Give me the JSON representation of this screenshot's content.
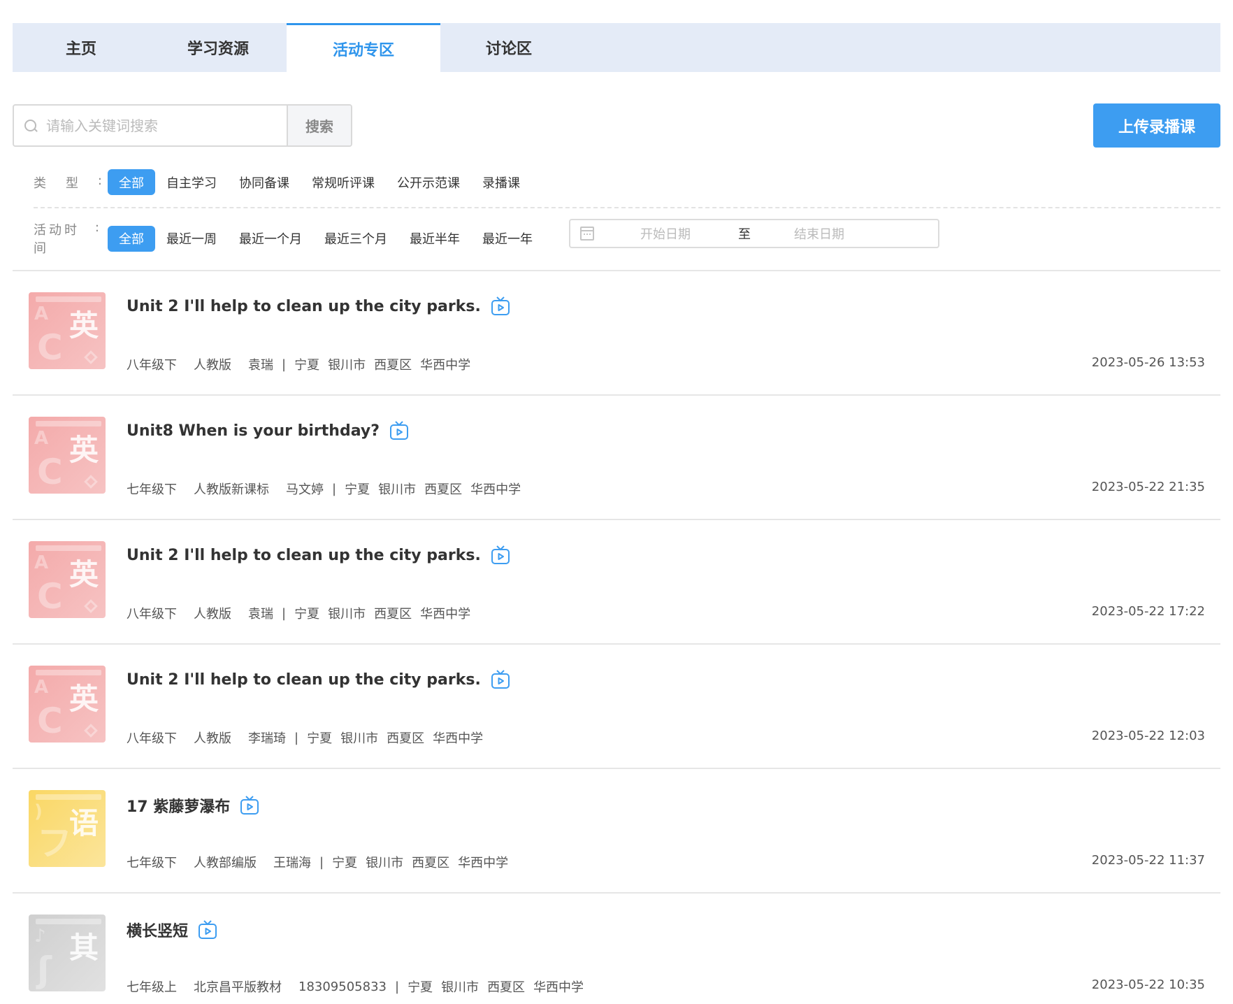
{
  "tabs": [
    {
      "label": "主页"
    },
    {
      "label": "学习资源"
    },
    {
      "label": "活动专区"
    },
    {
      "label": "讨论区"
    }
  ],
  "search": {
    "placeholder": "请输入关键词搜索",
    "button_label": "搜索"
  },
  "upload_button_label": "上传录播课",
  "filters": {
    "type": {
      "label_chars": [
        "类",
        "型",
        ":"
      ],
      "options": [
        "全部",
        "自主学习",
        "协同备课",
        "常规听评课",
        "公开示范课",
        "录播课"
      ],
      "selected": "全部"
    },
    "time": {
      "label_chars": [
        "活动时间",
        ":"
      ],
      "options": [
        "全部",
        "最近一周",
        "最近一个月",
        "最近三个月",
        "最近半年",
        "最近一年"
      ],
      "selected": "全部"
    },
    "date_range": {
      "start_placeholder": "开始日期",
      "separator": "至",
      "end_placeholder": "结束日期"
    }
  },
  "accent_color": "#3d9df1",
  "items": [
    {
      "title": "Unit 2 I'll help to clean up the city parks.",
      "subject_glyph": "英",
      "thumb_color": "red",
      "grade": "八年级下",
      "edition": "人教版",
      "teacher": "袁瑞",
      "sep": "|",
      "province": "宁夏",
      "city": "银川市",
      "district": "西夏区",
      "school": "华西中学",
      "date": "2023-05-26 13:53"
    },
    {
      "title": "Unit8 When is your birthday?",
      "subject_glyph": "英",
      "thumb_color": "red",
      "grade": "七年级下",
      "edition": "人教版新课标",
      "teacher": "马文婷",
      "sep": "|",
      "province": "宁夏",
      "city": "银川市",
      "district": "西夏区",
      "school": "华西中学",
      "date": "2023-05-22 21:35"
    },
    {
      "title": "Unit 2 I'll help to clean up the city parks.",
      "subject_glyph": "英",
      "thumb_color": "red",
      "grade": "八年级下",
      "edition": "人教版",
      "teacher": "袁瑞",
      "sep": "|",
      "province": "宁夏",
      "city": "银川市",
      "district": "西夏区",
      "school": "华西中学",
      "date": "2023-05-22 17:22"
    },
    {
      "title": "Unit 2 I'll help to clean up the city parks.",
      "subject_glyph": "英",
      "thumb_color": "red",
      "grade": "八年级下",
      "edition": "人教版",
      "teacher": "李瑞琦",
      "sep": "|",
      "province": "宁夏",
      "city": "银川市",
      "district": "西夏区",
      "school": "华西中学",
      "date": "2023-05-22 12:03"
    },
    {
      "title": "17 紫藤萝瀑布",
      "subject_glyph": "语",
      "thumb_color": "yellow",
      "grade": "七年级下",
      "edition": "人教部编版",
      "teacher": "王瑞海",
      "sep": "|",
      "province": "宁夏",
      "city": "银川市",
      "district": "西夏区",
      "school": "华西中学",
      "date": "2023-05-22 11:37"
    },
    {
      "title": "横长竖短",
      "subject_glyph": "其",
      "thumb_color": "gray",
      "grade": "七年级上",
      "edition": "北京昌平版教材",
      "teacher": "18309505833",
      "sep": "|",
      "province": "宁夏",
      "city": "银川市",
      "district": "西夏区",
      "school": "华西中学",
      "date": "2023-05-22 10:35"
    }
  ]
}
